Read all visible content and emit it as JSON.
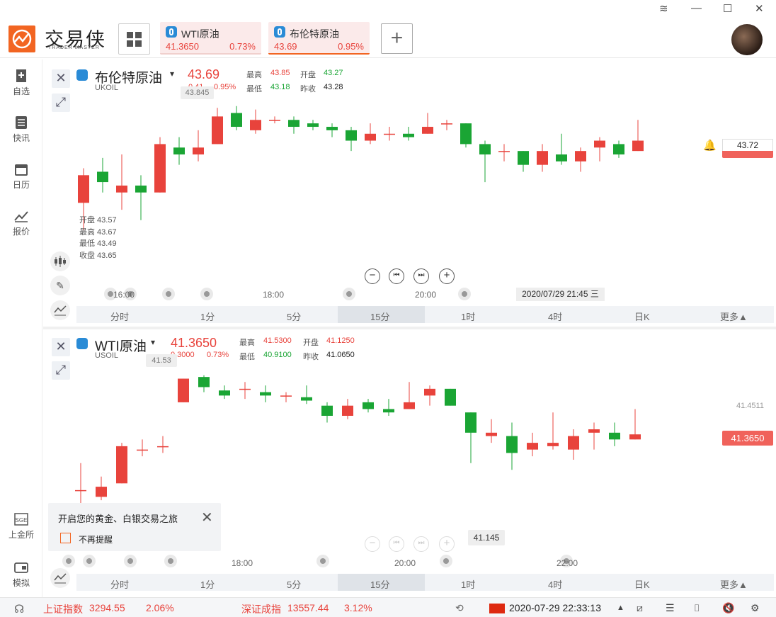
{
  "window": {
    "min": "—",
    "max": "☐",
    "close": "✕",
    "layers": "≋"
  },
  "brand": {
    "name": "交易侠",
    "sub": "TRADER MASTER"
  },
  "tabs": [
    {
      "name": "WTI原油",
      "price": "41.3650",
      "change": "0.73%"
    },
    {
      "name": "布伦特原油",
      "price": "43.69",
      "change": "0.95%"
    }
  ],
  "sidebar": [
    {
      "label": "自选"
    },
    {
      "label": "快讯"
    },
    {
      "label": "日历"
    },
    {
      "label": "报价"
    },
    {
      "label": "上金所"
    },
    {
      "label": "模拟"
    }
  ],
  "panel1": {
    "name": "布伦特原油",
    "code": "UKOIL",
    "price": "43.69",
    "change": "0.41",
    "change_pct": "0.95%",
    "high_label": "最高",
    "high": "43.85",
    "low_label": "最低",
    "low": "43.18",
    "open_label": "开盘",
    "open": "43.27",
    "prev_label": "昨收",
    "prev": "43.28",
    "peak_tip": "43.845",
    "ohlc": [
      "开盘 43.57",
      "最高 43.67",
      "最低 43.49",
      "收盘 43.65"
    ],
    "times": [
      "16:00",
      "18:00",
      "20:00"
    ],
    "datetime": "2020/07/29 21:45 三",
    "alert_price": "43.72",
    "cur_tag": "43.69"
  },
  "panel2": {
    "name": "WTI原油",
    "code": "USOIL",
    "price": "41.3650",
    "change": "0.3000",
    "change_pct": "0.73%",
    "high_label": "最高",
    "high": "41.5300",
    "low_label": "最低",
    "low": "40.9100",
    "open_label": "开盘",
    "open": "41.1250",
    "prev_label": "昨收",
    "prev": "41.0650",
    "peak_tip": "41.53",
    "low_tip": "41.145",
    "right_level": "41.4511",
    "cur_tag": "41.3650",
    "times": [
      "18:00",
      "20:00",
      "22:00"
    ]
  },
  "periods": [
    "分时",
    "1分",
    "5分",
    "15分",
    "1时",
    "4时",
    "日K",
    "更多▲"
  ],
  "popup": {
    "title": "开启您的黄金、白银交易之旅",
    "checkbox": "不再提醒"
  },
  "status": {
    "sh_name": "上证指数",
    "sh_val": "3294.55",
    "sh_pct": "2.06%",
    "sz_name": "深证成指",
    "sz_val": "13557.44",
    "sz_pct": "3.12%",
    "clock": "2020-07-29 22:33:13"
  },
  "chart_data": [
    {
      "type": "candlestick",
      "title": "布伦特原油 UKOIL",
      "series": [
        {
          "o": 43.57,
          "c": 43.65,
          "h": 43.67,
          "l": 43.49
        },
        {
          "o": 43.66,
          "c": 43.63,
          "h": 43.7,
          "l": 43.6
        },
        {
          "o": 43.6,
          "c": 43.62,
          "h": 43.71,
          "l": 43.55
        },
        {
          "o": 43.62,
          "c": 43.6,
          "h": 43.65,
          "l": 43.52
        },
        {
          "o": 43.6,
          "c": 43.74,
          "h": 43.76,
          "l": 43.6
        },
        {
          "o": 43.73,
          "c": 43.71,
          "h": 43.76,
          "l": 43.68
        },
        {
          "o": 43.71,
          "c": 43.73,
          "h": 43.78,
          "l": 43.69
        },
        {
          "o": 43.74,
          "c": 43.82,
          "h": 43.845,
          "l": 43.74
        },
        {
          "o": 43.83,
          "c": 43.79,
          "h": 43.85,
          "l": 43.78
        },
        {
          "o": 43.78,
          "c": 43.81,
          "h": 43.84,
          "l": 43.77
        },
        {
          "o": 43.81,
          "c": 43.81,
          "h": 43.82,
          "l": 43.8
        },
        {
          "o": 43.81,
          "c": 43.79,
          "h": 43.82,
          "l": 43.77
        },
        {
          "o": 43.8,
          "c": 43.79,
          "h": 43.81,
          "l": 43.78
        },
        {
          "o": 43.79,
          "c": 43.78,
          "h": 43.8,
          "l": 43.76
        },
        {
          "o": 43.78,
          "c": 43.75,
          "h": 43.79,
          "l": 43.72
        },
        {
          "o": 43.75,
          "c": 43.77,
          "h": 43.8,
          "l": 43.74
        },
        {
          "o": 43.77,
          "c": 43.77,
          "h": 43.79,
          "l": 43.75
        },
        {
          "o": 43.77,
          "c": 43.76,
          "h": 43.79,
          "l": 43.75
        },
        {
          "o": 43.77,
          "c": 43.79,
          "h": 43.83,
          "l": 43.77
        },
        {
          "o": 43.8,
          "c": 43.8,
          "h": 43.81,
          "l": 43.78
        },
        {
          "o": 43.8,
          "c": 43.74,
          "h": 43.8,
          "l": 43.73
        },
        {
          "o": 43.74,
          "c": 43.71,
          "h": 43.75,
          "l": 43.63
        },
        {
          "o": 43.72,
          "c": 43.72,
          "h": 43.74,
          "l": 43.69
        },
        {
          "o": 43.72,
          "c": 43.68,
          "h": 43.72,
          "l": 43.66
        },
        {
          "o": 43.68,
          "c": 43.72,
          "h": 43.74,
          "l": 43.66
        },
        {
          "o": 43.71,
          "c": 43.69,
          "h": 43.77,
          "l": 43.68
        },
        {
          "o": 43.69,
          "c": 43.72,
          "h": 43.73,
          "l": 43.66
        },
        {
          "o": 43.73,
          "c": 43.75,
          "h": 43.76,
          "l": 43.69
        },
        {
          "o": 43.74,
          "c": 43.71,
          "h": 43.75,
          "l": 43.7
        },
        {
          "o": 43.72,
          "c": 43.75,
          "h": 43.81,
          "l": 43.72
        }
      ]
    },
    {
      "type": "candlestick",
      "title": "WTI原油 USOIL",
      "series": [
        {
          "o": 41.2,
          "c": 41.2,
          "h": 41.28,
          "l": 41.13
        },
        {
          "o": 41.18,
          "c": 41.21,
          "h": 41.24,
          "l": 41.17
        },
        {
          "o": 41.22,
          "c": 41.33,
          "h": 41.34,
          "l": 41.22
        },
        {
          "o": 41.32,
          "c": 41.32,
          "h": 41.35,
          "l": 41.3
        },
        {
          "o": 41.33,
          "c": 41.33,
          "h": 41.36,
          "l": 41.31
        },
        {
          "o": 41.46,
          "c": 41.53,
          "h": 41.53,
          "l": 41.46
        },
        {
          "o": 41.535,
          "c": 41.505,
          "h": 41.54,
          "l": 41.49
        },
        {
          "o": 41.495,
          "c": 41.48,
          "h": 41.51,
          "l": 41.47
        },
        {
          "o": 41.5,
          "c": 41.5,
          "h": 41.52,
          "l": 41.47
        },
        {
          "o": 41.49,
          "c": 41.48,
          "h": 41.51,
          "l": 41.46
        },
        {
          "o": 41.48,
          "c": 41.48,
          "h": 41.49,
          "l": 41.46
        },
        {
          "o": 41.475,
          "c": 41.465,
          "h": 41.51,
          "l": 41.455
        },
        {
          "o": 41.45,
          "c": 41.42,
          "h": 41.46,
          "l": 41.4
        },
        {
          "o": 41.42,
          "c": 41.45,
          "h": 41.47,
          "l": 41.41
        },
        {
          "o": 41.46,
          "c": 41.44,
          "h": 41.47,
          "l": 41.43
        },
        {
          "o": 41.44,
          "c": 41.43,
          "h": 41.47,
          "l": 41.42
        },
        {
          "o": 41.44,
          "c": 41.46,
          "h": 41.52,
          "l": 41.44
        },
        {
          "o": 41.48,
          "c": 41.5,
          "h": 41.51,
          "l": 41.45
        },
        {
          "o": 41.5,
          "c": 41.45,
          "h": 41.5,
          "l": 41.45
        },
        {
          "o": 41.43,
          "c": 41.37,
          "h": 41.43,
          "l": 41.28
        },
        {
          "o": 41.36,
          "c": 41.37,
          "h": 41.41,
          "l": 41.34
        },
        {
          "o": 41.36,
          "c": 41.31,
          "h": 41.4,
          "l": 41.26
        },
        {
          "o": 41.32,
          "c": 41.34,
          "h": 41.37,
          "l": 41.3
        },
        {
          "o": 41.33,
          "c": 41.34,
          "h": 41.43,
          "l": 41.32
        },
        {
          "o": 41.32,
          "c": 41.36,
          "h": 41.38,
          "l": 41.29
        },
        {
          "o": 41.37,
          "c": 41.38,
          "h": 41.4,
          "l": 41.32
        },
        {
          "o": 41.37,
          "c": 41.35,
          "h": 41.4,
          "l": 41.33
        },
        {
          "o": 41.35,
          "c": 41.365,
          "h": 41.44,
          "l": 41.35
        }
      ]
    }
  ]
}
